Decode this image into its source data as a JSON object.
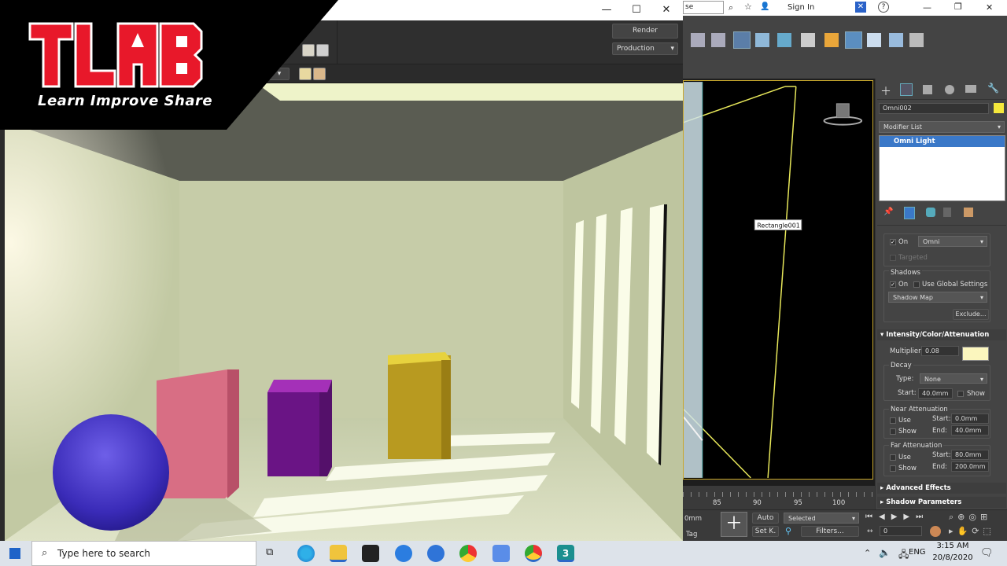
{
  "logo": {
    "main_text": "TLAB",
    "tagline": "Learn Improve Share"
  },
  "render_window": {
    "controls": {
      "minimize": "—",
      "maximize": "☐",
      "close": "✕"
    },
    "render_button": "Render",
    "render_mode": "Production"
  },
  "max_top": {
    "search_fragment": "se",
    "sign_in": "Sign In",
    "help": "?",
    "win_controls": {
      "minimize": "—",
      "restore": "❐",
      "close": "✕"
    }
  },
  "viewport": {
    "object_label": "Rectangle001"
  },
  "command_panel": {
    "object_name": "Omni002",
    "object_color": "#f5e83c",
    "modifier_list": "Modifier List",
    "modifier_stack_item": "Omni Light",
    "general": {
      "on_label": "On",
      "light_type": "Omni",
      "targeted_label": "Targeted",
      "shadows_label": "Shadows",
      "shadows_on_label": "On",
      "use_global_label": "Use Global Settings",
      "shadow_type": "Shadow Map",
      "exclude_button": "Exclude..."
    },
    "intensity": {
      "header": "Intensity/Color/Attenuation",
      "multiplier_label": "Multiplier:",
      "multiplier_value": "0.08",
      "color_swatch": "#fbf6be",
      "decay_label": "Decay",
      "type_label": "Type:",
      "type_value": "None",
      "start_label": "Start:",
      "start_value": "40.0mm",
      "show_label": "Show",
      "near_label": "Near Attenuation",
      "near_use": "Use",
      "near_show": "Show",
      "near_start_label": "Start:",
      "near_start_value": "0.0mm",
      "near_end_label": "End:",
      "near_end_value": "40.0mm",
      "far_label": "Far Attenuation",
      "far_use": "Use",
      "far_show": "Show",
      "far_start_label": "Start:",
      "far_start_value": "80.0mm",
      "far_end_label": "End:",
      "far_end_value": "200.0mm"
    },
    "advanced_effects": "Advanced Effects",
    "shadow_parameters": "Shadow Parameters"
  },
  "timeline": {
    "ticks": [
      "85",
      "90",
      "95",
      "100"
    ]
  },
  "anim_bar": {
    "units_fragment": "0mm",
    "tag_fragment": "Tag",
    "auto_button": "Auto",
    "selected_dropdown": "Selected",
    "set_key_button": "Set K.",
    "filters_button": "Filters...",
    "frame_value": "0"
  },
  "taskbar": {
    "search_placeholder": "Type here to search",
    "time": "3:15 AM",
    "date": "20/8/2020",
    "language": "ENG"
  }
}
